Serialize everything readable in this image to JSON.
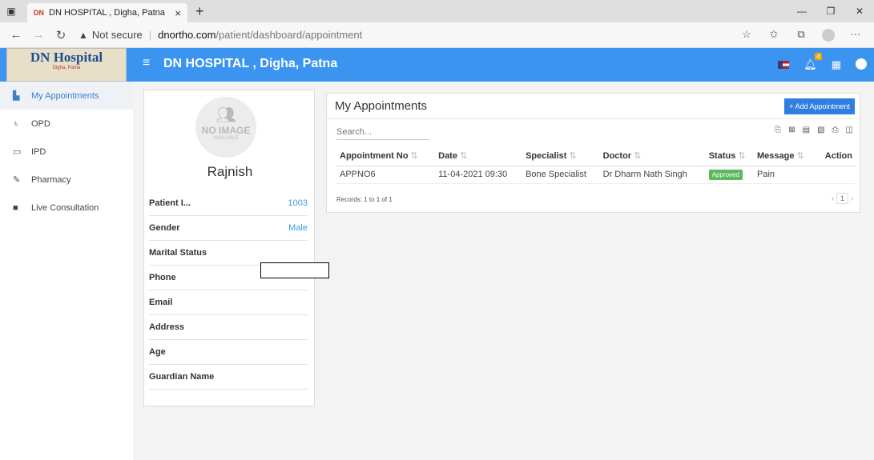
{
  "browser": {
    "tab_title": "DN HOSPITAL , Digha, Patna",
    "favicon": "DN",
    "close": "×",
    "new_tab": "+",
    "url_warning": "Not secure",
    "url_host": "dnortho.com",
    "url_path": "/patient/dashboard/appointment"
  },
  "header": {
    "logo_text": "DN Hospital",
    "logo_sub": "Digha, Patna",
    "title": "DN HOSPITAL , Digha, Patna",
    "notification_count": "4"
  },
  "sidebar": {
    "items": [
      {
        "label": "My Appointments",
        "icon": "hospital-icon"
      },
      {
        "label": "OPD",
        "icon": "stethoscope-icon"
      },
      {
        "label": "IPD",
        "icon": "bed-icon"
      },
      {
        "label": "Pharmacy",
        "icon": "pill-icon"
      },
      {
        "label": "Live Consultation",
        "icon": "video-icon"
      }
    ]
  },
  "profile": {
    "no_image_main": "NO IMAGE",
    "no_image_sub": "AVAILABLE",
    "name": "Rajnish",
    "rows": [
      {
        "label": "Patient I...",
        "value": "1003"
      },
      {
        "label": "Gender",
        "value": "Male"
      },
      {
        "label": "Marital Status",
        "value": ""
      },
      {
        "label": "Phone",
        "value": ""
      },
      {
        "label": "Email",
        "value": ""
      },
      {
        "label": "Address",
        "value": ""
      },
      {
        "label": "Age",
        "value": ""
      },
      {
        "label": "Guardian Name",
        "value": ""
      }
    ]
  },
  "appointments": {
    "title": "My Appointments",
    "add_button": "+ Add Appointment",
    "search_placeholder": "Search...",
    "columns": [
      "Appointment No",
      "Date",
      "Specialist",
      "Doctor",
      "Status",
      "Message",
      "Action"
    ],
    "rows": [
      {
        "appointment_no": "APPNO6",
        "date": "11-04-2021 09:30",
        "specialist": "Bone Specialist",
        "doctor": "Dr Dharm Nath Singh",
        "status": "Approved",
        "message": "Pain",
        "action": ""
      }
    ],
    "records_text": "Records: 1 to 1 of 1",
    "current_page": "1"
  },
  "colors": {
    "topbar": "#3b95f0",
    "accent": "#2f7fe0",
    "approved": "#5cb85c",
    "link_value": "#3b9be0"
  }
}
